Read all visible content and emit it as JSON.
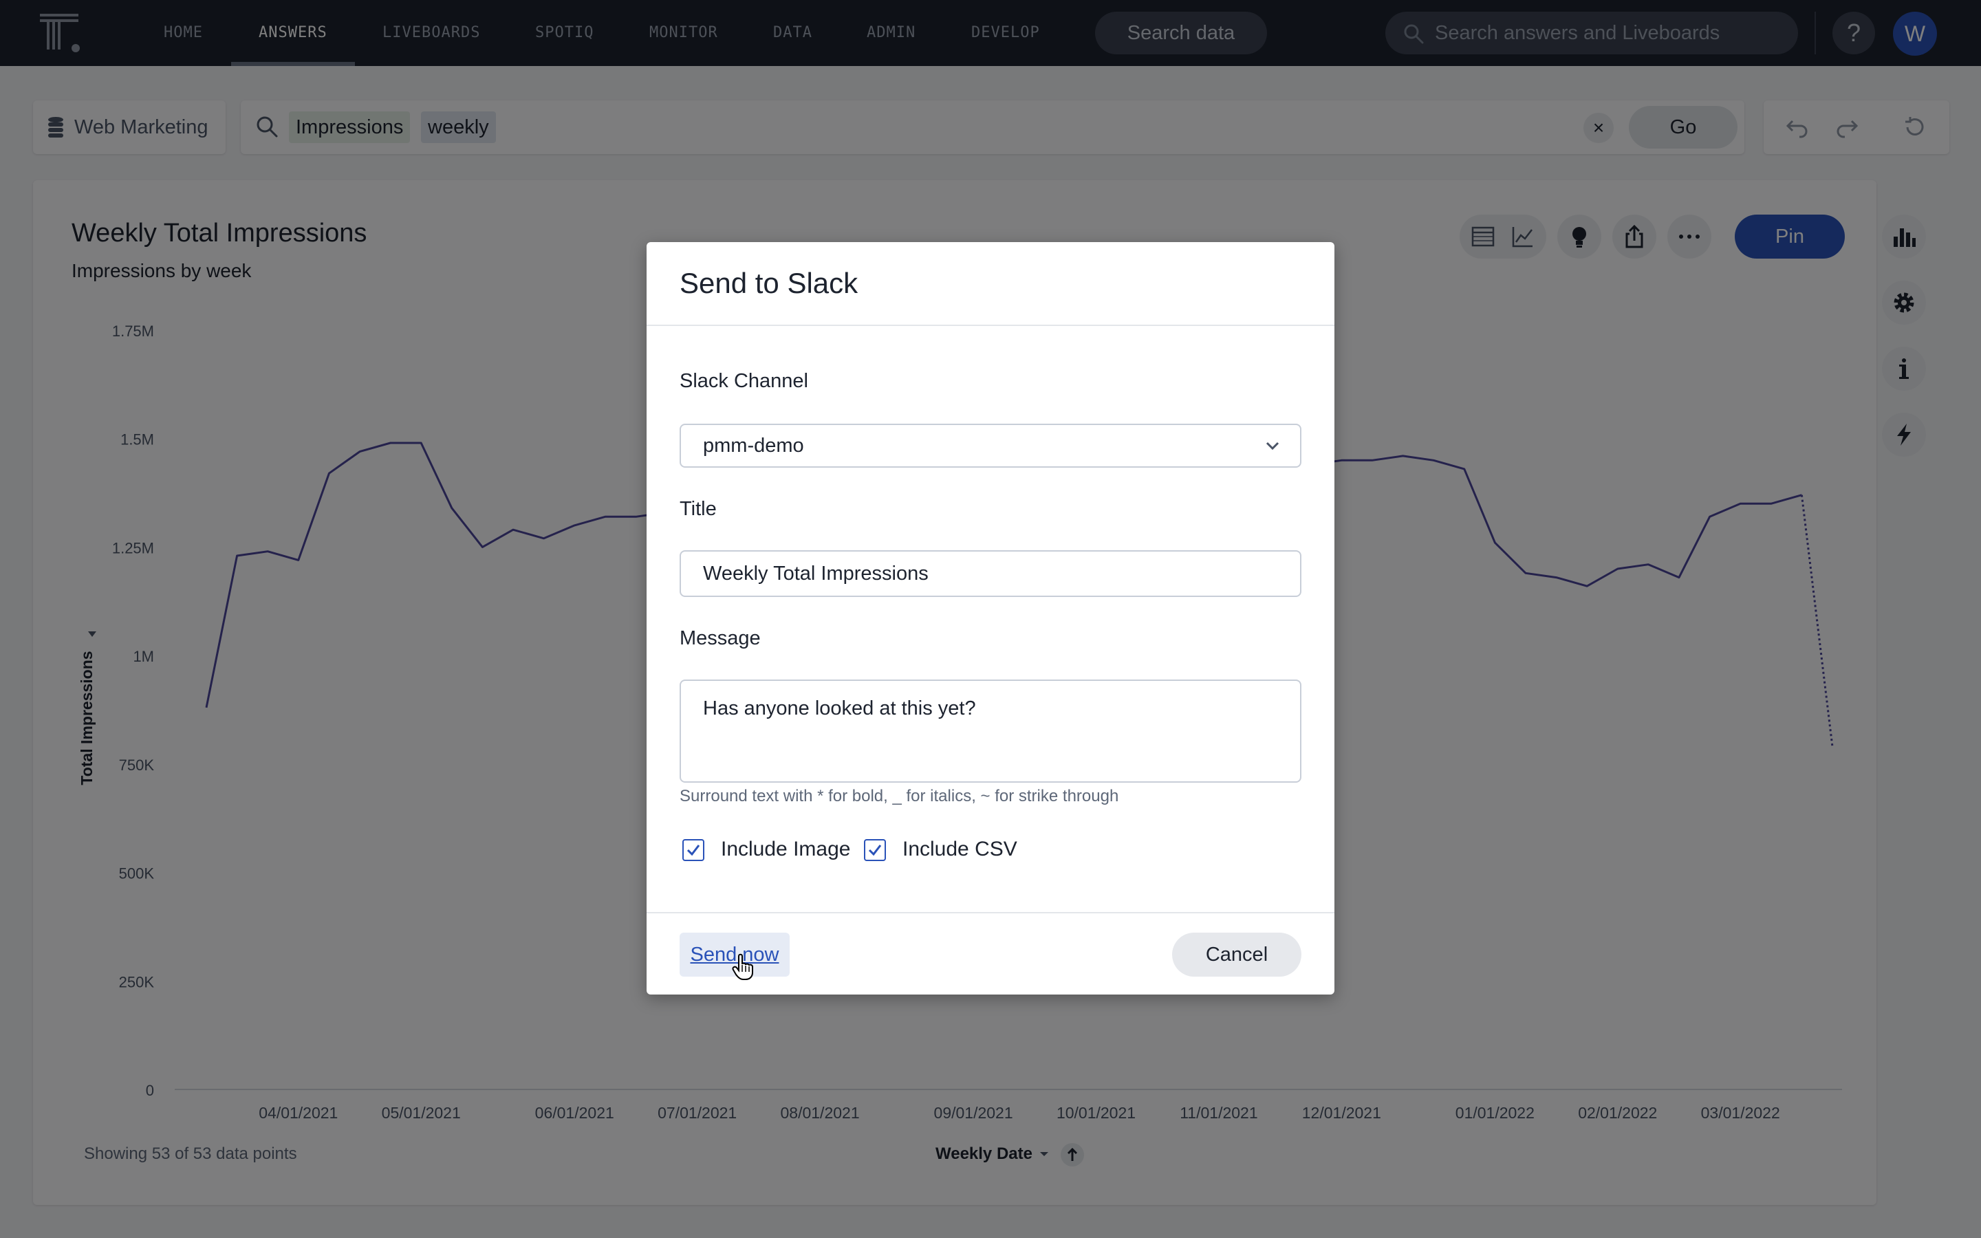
{
  "nav": {
    "items": [
      {
        "label": "HOME",
        "active": false
      },
      {
        "label": "ANSWERS",
        "active": true
      },
      {
        "label": "LIVEBOARDS",
        "active": false
      },
      {
        "label": "SPOTIQ",
        "active": false
      },
      {
        "label": "MONITOR",
        "active": false
      },
      {
        "label": "DATA",
        "active": false
      },
      {
        "label": "ADMIN",
        "active": false
      },
      {
        "label": "DEVELOP",
        "active": false
      }
    ],
    "search_data_label": "Search data",
    "global_search_placeholder": "Search answers and Liveboards",
    "help_icon": "?",
    "avatar_initial": "W"
  },
  "search": {
    "source_label": "Web Marketing",
    "tokens": [
      "Impressions",
      "weekly"
    ],
    "clear_icon": "×",
    "go_label": "Go"
  },
  "answer": {
    "title": "Weekly Total Impressions",
    "subtitle": "Impressions by week",
    "pin_label": "Pin",
    "footer_note": "Showing 53 of 53 data points",
    "x_axis_title": "Weekly Date"
  },
  "chart_data": {
    "type": "line",
    "title": "Weekly Total Impressions",
    "subtitle": "Impressions by week",
    "xlabel": "Weekly Date",
    "ylabel": "Total Impressions",
    "ylim": [
      0,
      1750000
    ],
    "y_ticks": [
      {
        "value": 0,
        "label": "0"
      },
      {
        "value": 250000,
        "label": "250K"
      },
      {
        "value": 500000,
        "label": "500K"
      },
      {
        "value": 750000,
        "label": "750K"
      },
      {
        "value": 1000000,
        "label": "1M"
      },
      {
        "value": 1250000,
        "label": "1.25M"
      },
      {
        "value": 1500000,
        "label": "1.5M"
      },
      {
        "value": 1750000,
        "label": "1.75M"
      }
    ],
    "x_ticks": [
      "04/01/2021",
      "05/01/2021",
      "06/01/2021",
      "07/01/2021",
      "08/01/2021",
      "09/01/2021",
      "10/01/2021",
      "11/01/2021",
      "12/01/2021",
      "01/01/2022",
      "02/01/2022",
      "03/01/2022"
    ],
    "x_tick_index": [
      3,
      7,
      12,
      16,
      20,
      25,
      29,
      33,
      37,
      42,
      46,
      50
    ],
    "series": [
      {
        "color": "#4a4599",
        "dotted_last_segment": true,
        "values": [
          880000,
          1230000,
          1240000,
          1220000,
          1420000,
          1470000,
          1490000,
          1490000,
          1340000,
          1250000,
          1290000,
          1270000,
          1300000,
          1320000,
          1320000,
          1330000,
          1320000,
          1310000,
          1300000,
          1310000,
          1300000,
          1320000,
          1330000,
          1330000,
          1320000,
          1310000,
          1300000,
          1310000,
          1300000,
          1320000,
          1340000,
          1360000,
          1380000,
          1400000,
          1420000,
          1430000,
          1440000,
          1450000,
          1450000,
          1460000,
          1450000,
          1430000,
          1260000,
          1190000,
          1180000,
          1160000,
          1200000,
          1210000,
          1180000,
          1320000,
          1350000,
          1350000,
          1370000,
          790000
        ]
      }
    ],
    "grid": false,
    "legend": "none"
  },
  "modal": {
    "title": "Send to Slack",
    "channel_label": "Slack Channel",
    "channel_value": "pmm-demo",
    "title_label": "Title",
    "title_value": "Weekly Total Impressions",
    "message_label": "Message",
    "message_value": "Has anyone looked at this yet?",
    "hint": "Surround text with * for bold, _ for italics, ~ for strike through",
    "include_image_label": "Include Image",
    "include_image_checked": true,
    "include_csv_label": "Include CSV",
    "include_csv_checked": true,
    "send_label": "Send now",
    "cancel_label": "Cancel"
  },
  "colors": {
    "nav_bg": "#1d232f",
    "accent": "#2a52b8",
    "line": "#4a4599"
  }
}
